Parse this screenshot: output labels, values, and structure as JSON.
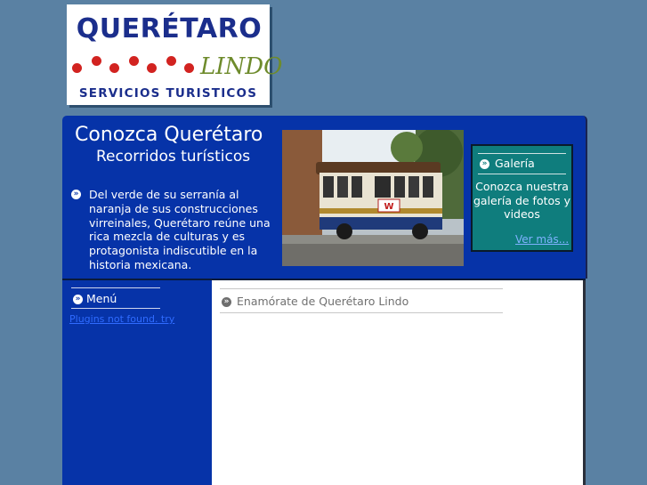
{
  "logo": {
    "title": "QUERÉTARO",
    "subtitle": "LINDO",
    "bottom": "SERVICIOS TURISTICOS",
    "dot_color": "#d22320",
    "text_color": "#1b2e8c"
  },
  "header": {
    "title": "Conozca Querétaro",
    "subtitle": "Recorridos turísticos",
    "description": "Del verde de su serranía al naranja de sus construcciones virreinales, Querétaro reúne una rica mezcla de culturas y es protagonista indiscutible en la historia mexicana.",
    "photo_sign": "W"
  },
  "galeria": {
    "heading": "Galería",
    "text": "Conozca nuestra galería de fotos y videos",
    "link": "Ver más..."
  },
  "sidebar": {
    "heading": "Menú",
    "link": "Plugins not found. try"
  },
  "content": {
    "heading": "Enamórate de Querétaro Lindo"
  },
  "colors": {
    "page_bg": "#5a81a3",
    "panel_blue": "#0633a8",
    "teal": "#0f7d7d"
  }
}
